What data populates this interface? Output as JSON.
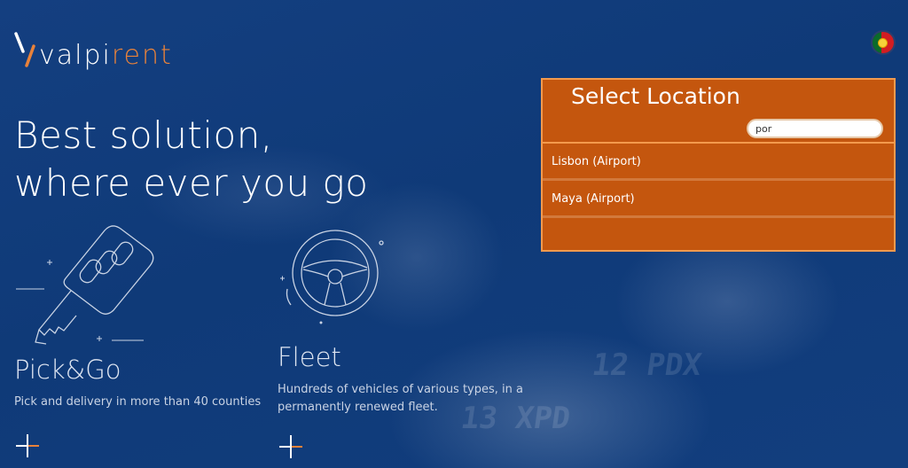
{
  "brand": {
    "logo_white": "valpi",
    "logo_orange": "rent"
  },
  "language": {
    "icon": "portugal-flag-icon"
  },
  "hero": {
    "line1": "Best solution,",
    "line2": "where ever you go"
  },
  "features": [
    {
      "icon": "car-key-icon",
      "title": "Pick&Go",
      "description": "Pick and delivery in more than 40 counties"
    },
    {
      "icon": "steering-wheel-icon",
      "title": "Fleet",
      "description_line1": "Hundreds of vehicles of various types, in a",
      "description_line2": "permanently renewed fleet."
    }
  ],
  "location_panel": {
    "title": "Select Location",
    "search_value": "por",
    "results": [
      "Lisbon (Airport)",
      "Maya (Airport)"
    ]
  },
  "background": {
    "plate1": "12 PDX",
    "plate2": "13 XPD"
  },
  "colors": {
    "background": "#103a7a",
    "accent": "#e8823a",
    "panel": "#c4560e",
    "panel_border": "#f39a4d"
  }
}
